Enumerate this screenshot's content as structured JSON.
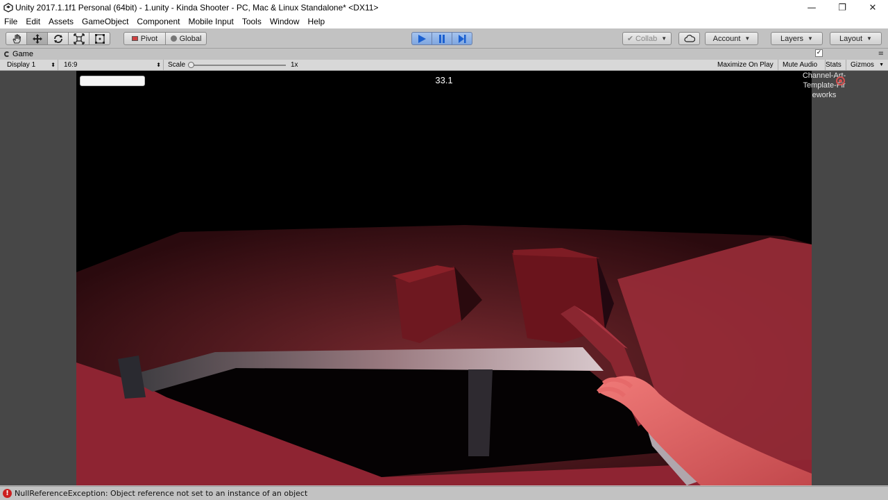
{
  "window": {
    "title": "Unity 2017.1.1f1 Personal (64bit) - 1.unity - Kinda Shooter - PC, Mac & Linux Standalone* <DX11>",
    "app_icon": "unity-logo-icon",
    "controls": {
      "minimize": "—",
      "restore": "❐",
      "close": "✕"
    }
  },
  "menu": [
    "File",
    "Edit",
    "Assets",
    "GameObject",
    "Component",
    "Mobile Input",
    "Tools",
    "Window",
    "Help"
  ],
  "toolbar": {
    "tools": [
      "hand-tool-icon",
      "move-tool-icon",
      "rotate-tool-icon",
      "scale-tool-icon",
      "rect-tool-icon"
    ],
    "pivot_label": "Pivot",
    "global_label": "Global",
    "play_controls": [
      "play-icon",
      "pause-icon",
      "step-icon"
    ],
    "collab_label": "Collab",
    "account_label": "Account",
    "layers_label": "Layers",
    "layout_label": "Layout"
  },
  "game_tab": {
    "label": "Game"
  },
  "game_bar": {
    "display": "Display 1",
    "aspect": "16:9",
    "scale_label": "Scale",
    "scale_value": "1x",
    "maximize_on_play": "Maximize On Play",
    "mute_audio": "Mute Audio",
    "stats": "Stats",
    "gizmos": "Gizmos"
  },
  "hud": {
    "timer": "33.1"
  },
  "side_text": {
    "line1": "Channel-Art-",
    "line2": "Template-Fir",
    "line3": "eworks"
  },
  "status": {
    "message": "NullReferenceException: Object reference not set to an instance of an object"
  },
  "colors": {
    "accent_play": "#7fa6df",
    "error": "#cc2020",
    "scene_red": "#8a2030"
  }
}
